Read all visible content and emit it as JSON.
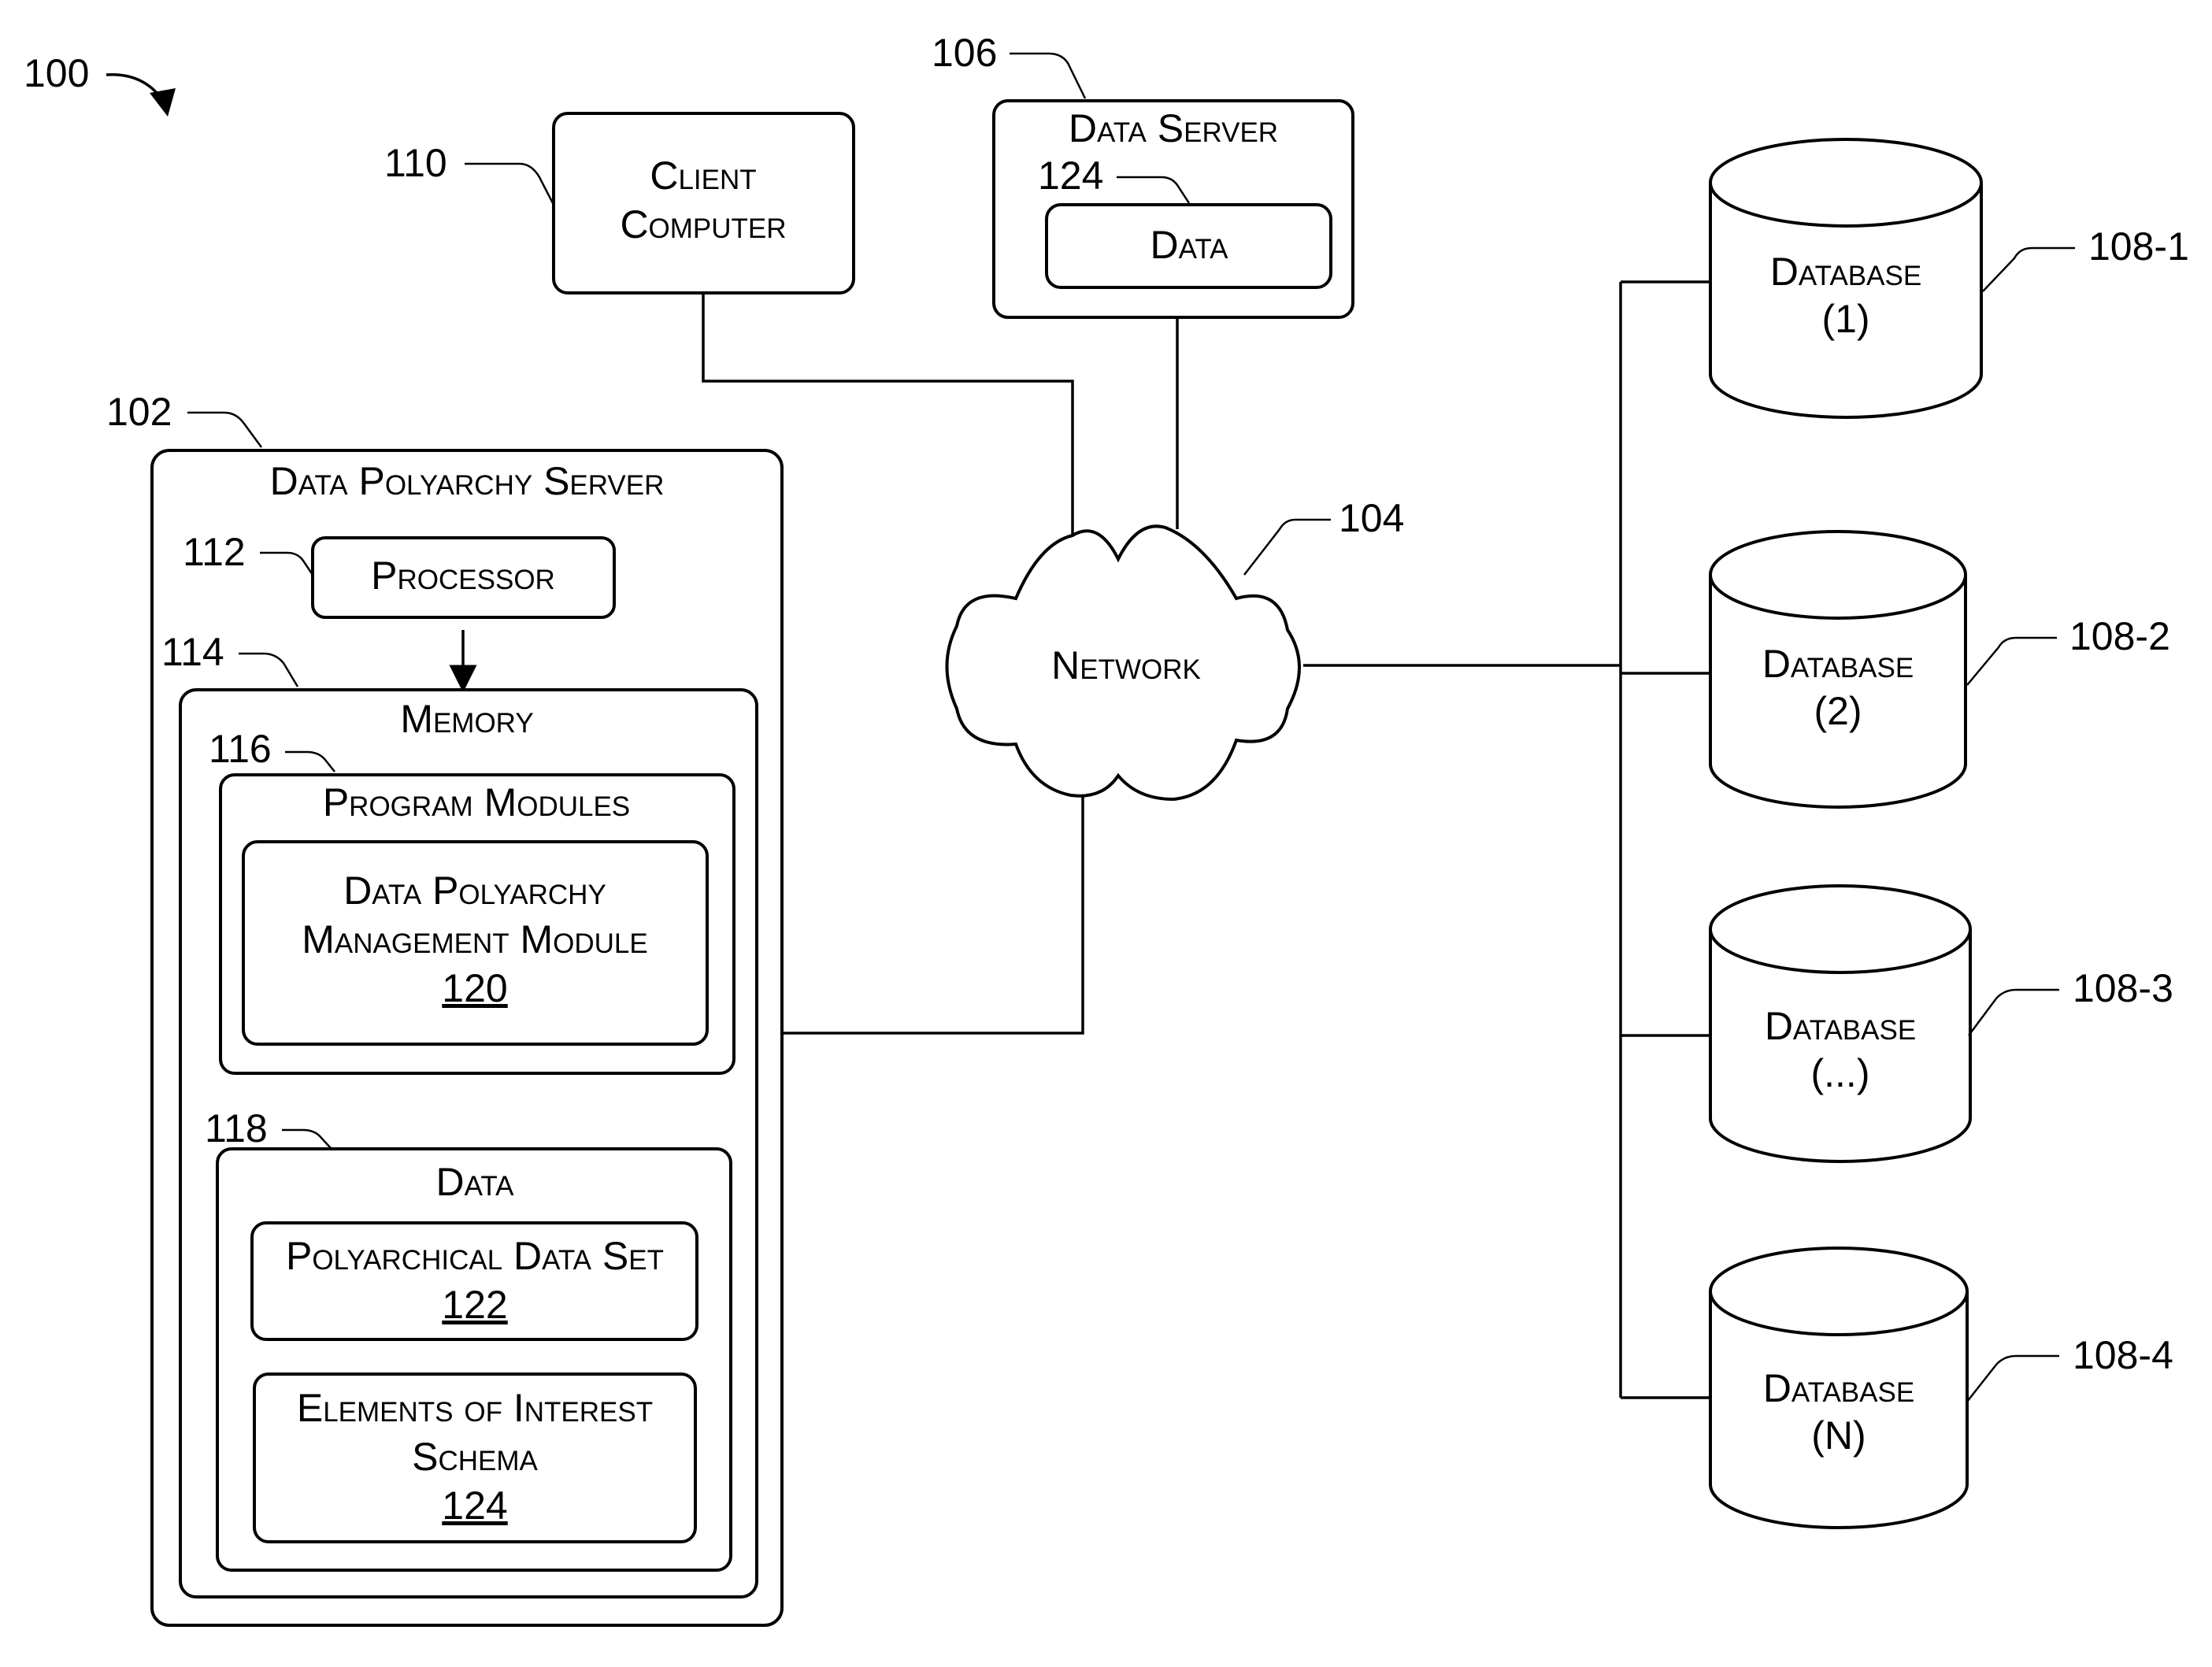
{
  "figure": {
    "ref": "100"
  },
  "client_computer": {
    "ref": "110",
    "label_line1": "Client",
    "label_line2": "Computer"
  },
  "data_server": {
    "ref": "106",
    "title": "Data Server",
    "data_ref": "124",
    "data_label": "Data"
  },
  "network": {
    "ref": "104",
    "label": "Network"
  },
  "dp_server": {
    "ref": "102",
    "title": "Data Polyarchy Server",
    "processor": {
      "ref": "112",
      "label": "Processor"
    },
    "memory": {
      "ref": "114",
      "label": "Memory",
      "program_modules": {
        "ref": "116",
        "label": "Program Modules",
        "module": {
          "line1": "Data Polyarchy",
          "line2": "Management Module",
          "num": "120"
        }
      },
      "data": {
        "ref": "118",
        "label": "Data",
        "items": [
          {
            "line1": "Polyarchical Data Set",
            "num": "122"
          },
          {
            "line1": "Elements of Interest",
            "line2": "Schema",
            "num": "124"
          }
        ]
      }
    }
  },
  "databases": [
    {
      "ref": "108-1",
      "label": "Database",
      "sub": "(1)"
    },
    {
      "ref": "108-2",
      "label": "Database",
      "sub": "(2)"
    },
    {
      "ref": "108-3",
      "label": "Database",
      "sub": "(...)"
    },
    {
      "ref": "108-4",
      "label": "Database",
      "sub": "(N)"
    }
  ]
}
